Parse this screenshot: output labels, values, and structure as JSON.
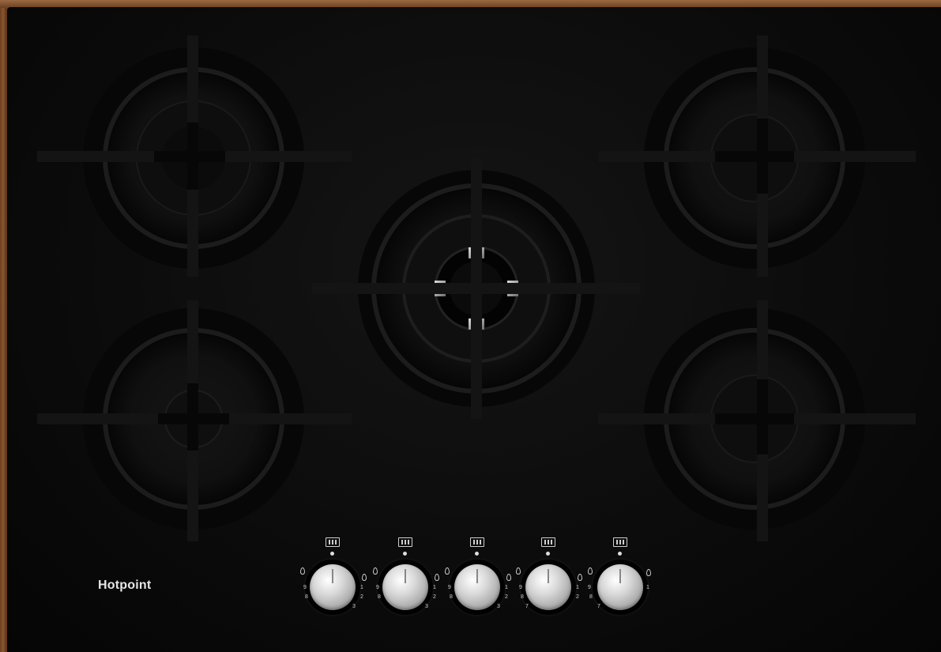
{
  "brand": "Hotpoint",
  "knobs": [
    {
      "id": "front-left",
      "marks": [
        "9",
        "8",
        "1",
        "2",
        "3"
      ]
    },
    {
      "id": "rear-left",
      "marks": [
        "9",
        "8",
        "1",
        "2",
        "3"
      ]
    },
    {
      "id": "centre",
      "marks": [
        "9",
        "8",
        "1",
        "2",
        "3"
      ]
    },
    {
      "id": "rear-right",
      "marks": [
        "9",
        "8",
        "7",
        "1",
        "2"
      ]
    },
    {
      "id": "front-right",
      "marks": [
        "9",
        "8",
        "7",
        "1"
      ]
    }
  ],
  "colors": {
    "glass": "#0b0b0b",
    "trim": "#7b4a26",
    "knob": "#c8c8c8",
    "text": "#e6e6e6"
  }
}
